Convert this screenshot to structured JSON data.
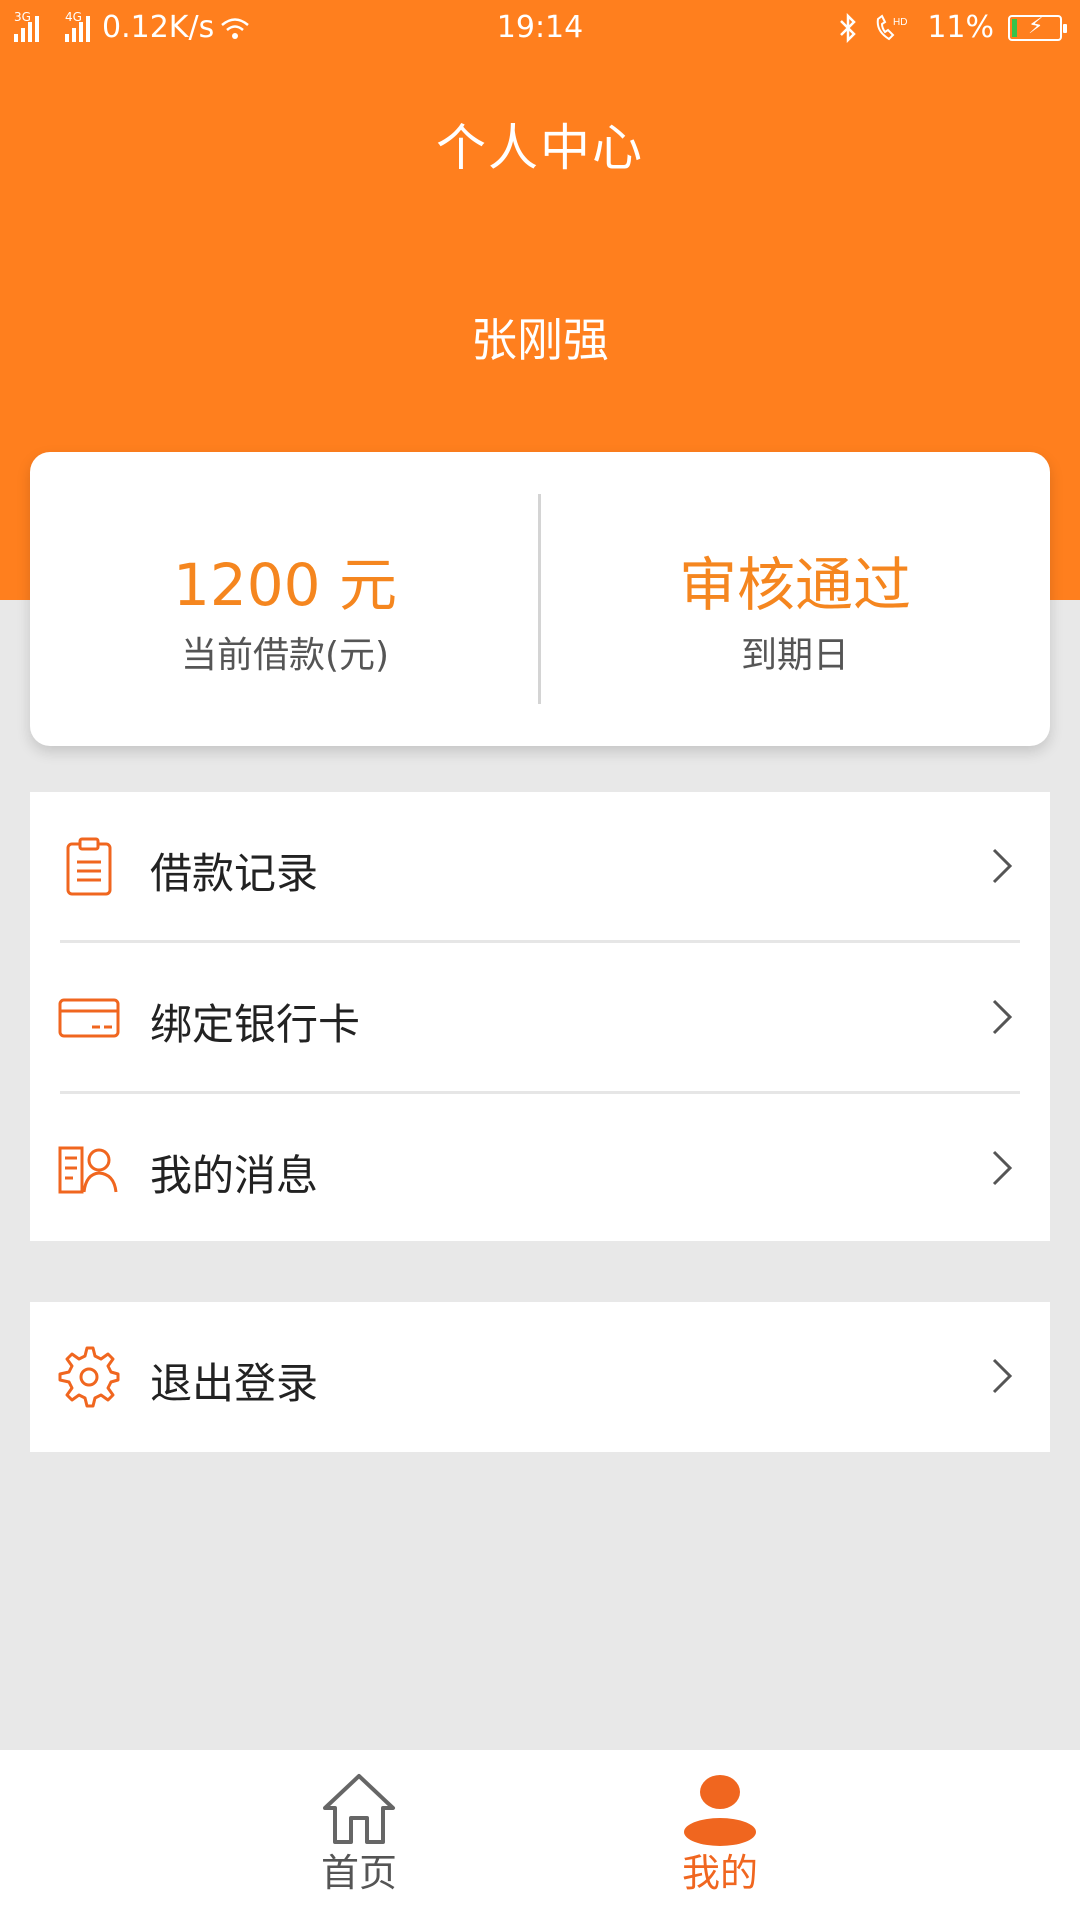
{
  "status_bar": {
    "net1": "3G",
    "net2": "4G",
    "speed": "0.12K/s",
    "time": "19:14",
    "battery": "11%",
    "battery_level": 0.11
  },
  "header": {
    "title": "个人中心",
    "user_name": "张刚强"
  },
  "summary": {
    "loan_value": "1200 元",
    "loan_label": "当前借款(元)",
    "status_value": "审核通过",
    "status_label": "到期日"
  },
  "menu": {
    "items": [
      {
        "label": "借款记录",
        "icon": "clipboard-icon"
      },
      {
        "label": "绑定银行卡",
        "icon": "bank-card-icon"
      },
      {
        "label": "我的消息",
        "icon": "message-user-icon"
      }
    ],
    "logout": {
      "label": "退出登录",
      "icon": "gear-icon"
    }
  },
  "tabbar": {
    "tabs": [
      {
        "label": "首页",
        "icon": "home-icon",
        "active": false
      },
      {
        "label": "我的",
        "icon": "user-icon",
        "active": true
      }
    ]
  },
  "colors": {
    "brand": "#ff7f1e",
    "accent_text": "#f5861f",
    "active_tab": "#f0661f",
    "background": "#e8e8e8"
  }
}
